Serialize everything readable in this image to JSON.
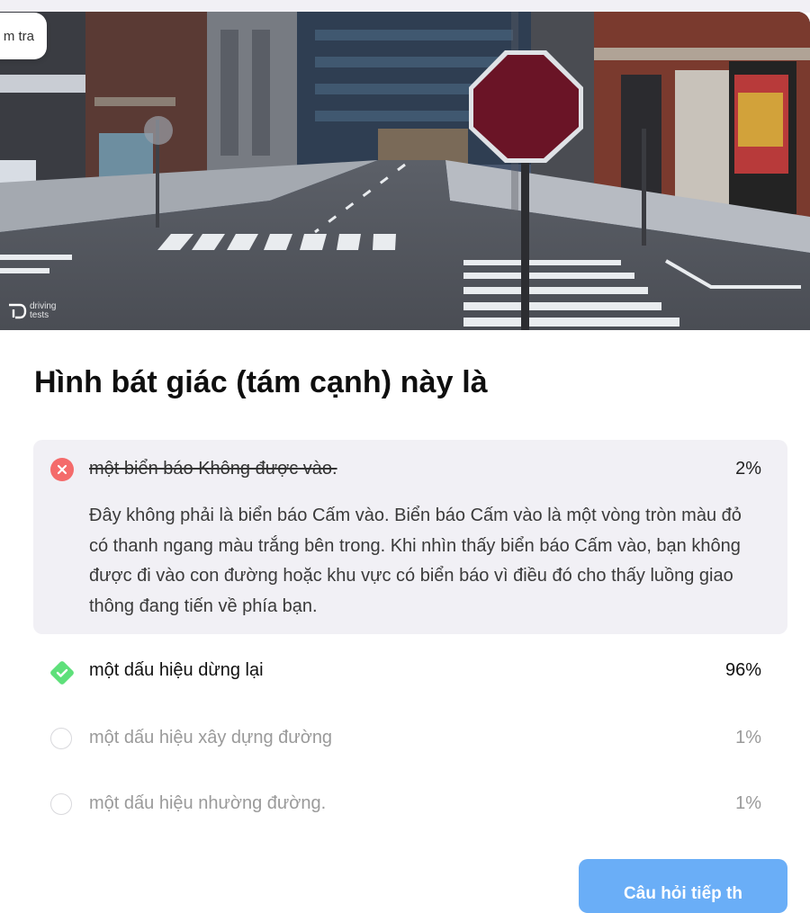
{
  "tab": {
    "label": "m tra"
  },
  "hero": {
    "watermark_line1": "driving",
    "watermark_line2": "tests"
  },
  "question": {
    "text": "Hình bát giác (tám cạnh) này là"
  },
  "options": [
    {
      "label": "một biển báo Không được vào.",
      "percent": "2%",
      "status": "wrong",
      "explanation": "Đây không phải là biển báo Cấm vào. Biển báo Cấm vào là một vòng tròn màu đỏ có thanh ngang màu trắng bên trong. Khi nhìn thấy biển báo Cấm vào, bạn không được đi vào con đường hoặc khu vực có biển báo vì điều đó cho thấy luồng giao thông đang tiến về phía bạn."
    },
    {
      "label": "một dấu hiệu dừng lại",
      "percent": "96%",
      "status": "correct"
    },
    {
      "label": "một dấu hiệu xây dựng đường",
      "percent": "1%",
      "status": "unselected"
    },
    {
      "label": "một dấu hiệu nhường đường.",
      "percent": "1%",
      "status": "unselected"
    }
  ],
  "next_button": {
    "label": "Câu hỏi tiếp th"
  },
  "colors": {
    "wrong": "#f46b6b",
    "correct": "#5ee07a",
    "button": "#6aaef7",
    "panel": "#f1f0f5",
    "sign": "#6a1426"
  },
  "icons": {
    "wrong": "close-icon",
    "correct": "check-icon",
    "unselected": "radio-empty-icon"
  }
}
